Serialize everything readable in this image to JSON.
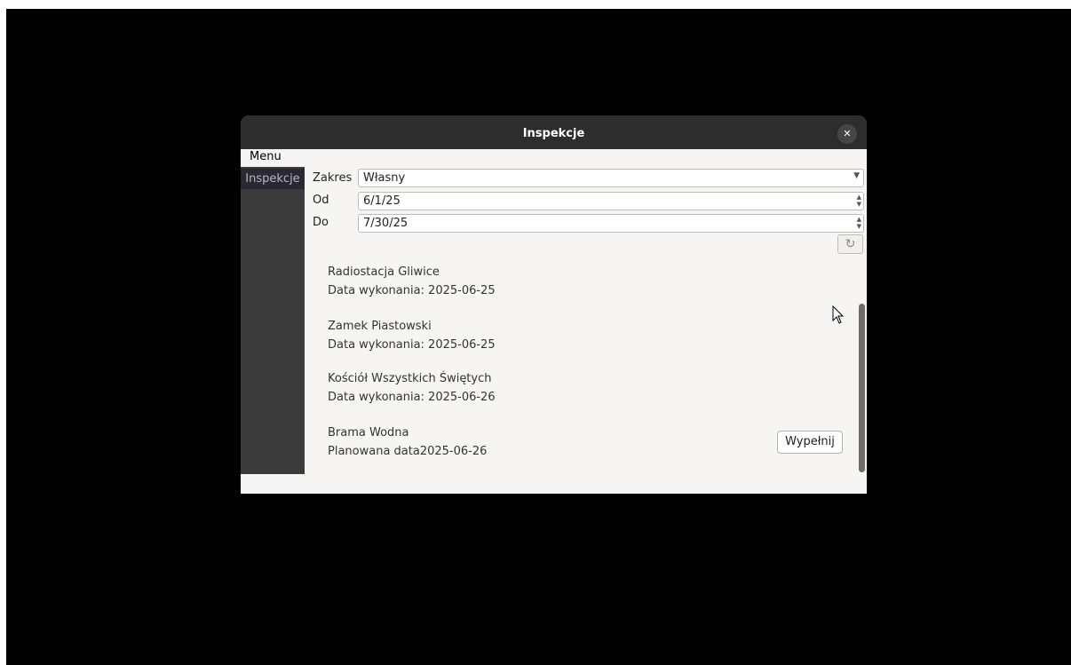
{
  "window": {
    "title": "Inspekcje",
    "close_glyph": "✕"
  },
  "menubar": {
    "menu_label": "Menu"
  },
  "sidebar": {
    "items": [
      {
        "label": "Inspekcje"
      }
    ]
  },
  "filters": {
    "range_label": "Zakres",
    "range_value": "Własny",
    "from_label": "Od",
    "from_value": "6/1/25",
    "to_label": "Do",
    "to_value": "7/30/25",
    "refresh_icon": "refresh-icon"
  },
  "inspections": [
    {
      "name": "Radiostacja Gliwice",
      "date_text": "Data wykonania: 2025-06-25"
    },
    {
      "name": "Zamek Piastowski",
      "date_text": "Data wykonania: 2025-06-25"
    },
    {
      "name": "Kościół Wszystkich Świętych",
      "date_text": "Data wykonania: 2025-06-26"
    },
    {
      "name": "Brama Wodna",
      "date_text": "Planowana data2025-06-26",
      "action_label": "Wypełnij"
    }
  ],
  "colors": {
    "titlebar": "#2d2d2d",
    "sidebar": "#3b3b3b",
    "sidebar_selected": "#2a2830",
    "window_bg": "#f6f5f4"
  }
}
